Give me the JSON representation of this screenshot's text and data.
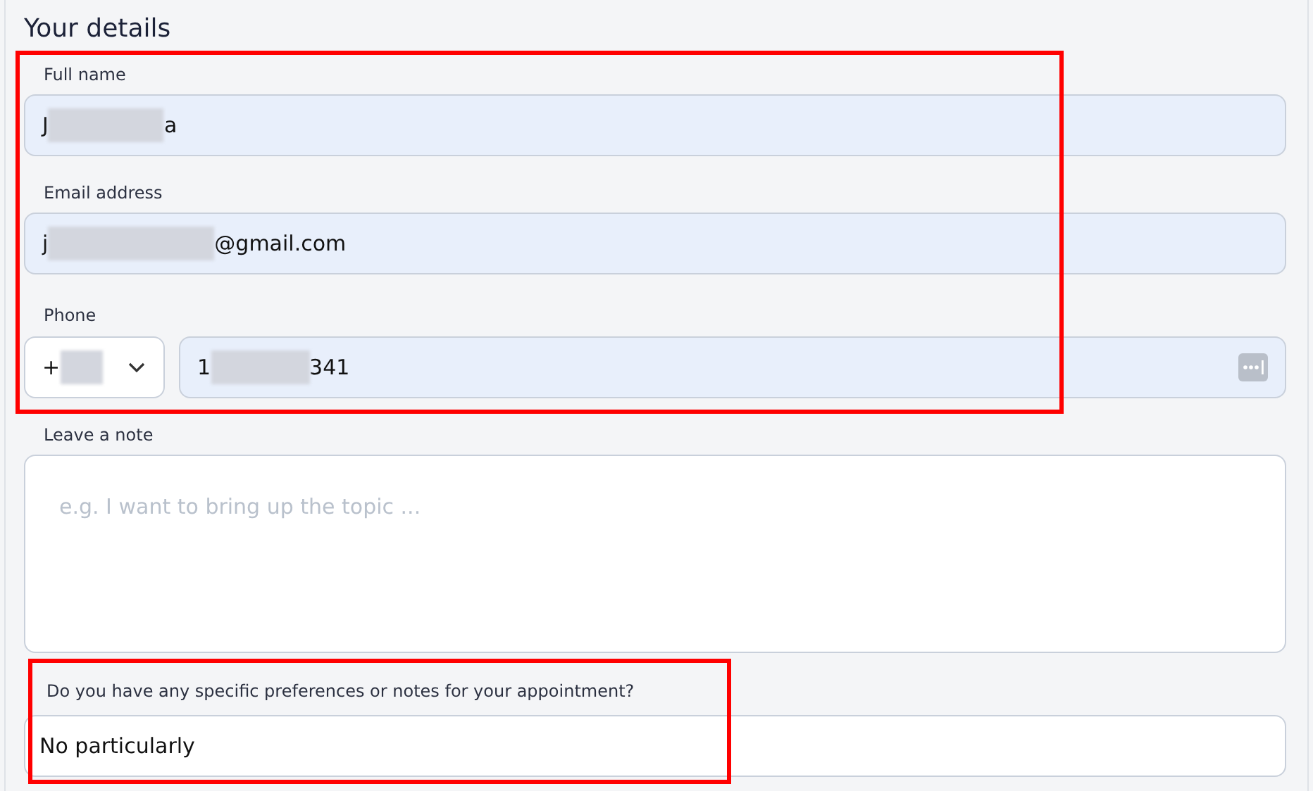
{
  "section": {
    "title": "Your details"
  },
  "highlights": {
    "contact_fields": true,
    "preferences": true
  },
  "full_name": {
    "label": "Full name",
    "value_start": "J",
    "value_end": "a",
    "redacted": true
  },
  "email": {
    "label": "Email address",
    "value_start": "j",
    "value_end": "@gmail.com",
    "redacted": true
  },
  "phone": {
    "label": "Phone",
    "country_code": "+",
    "country_redacted": true,
    "value_start": "1",
    "value_end": "341",
    "redacted": true
  },
  "note": {
    "label": "Leave a note",
    "placeholder": "e.g. I want to bring up the topic ..."
  },
  "preferences": {
    "label": "Do you have any specific preferences or notes for your appointment?",
    "value": "No particularly"
  }
}
